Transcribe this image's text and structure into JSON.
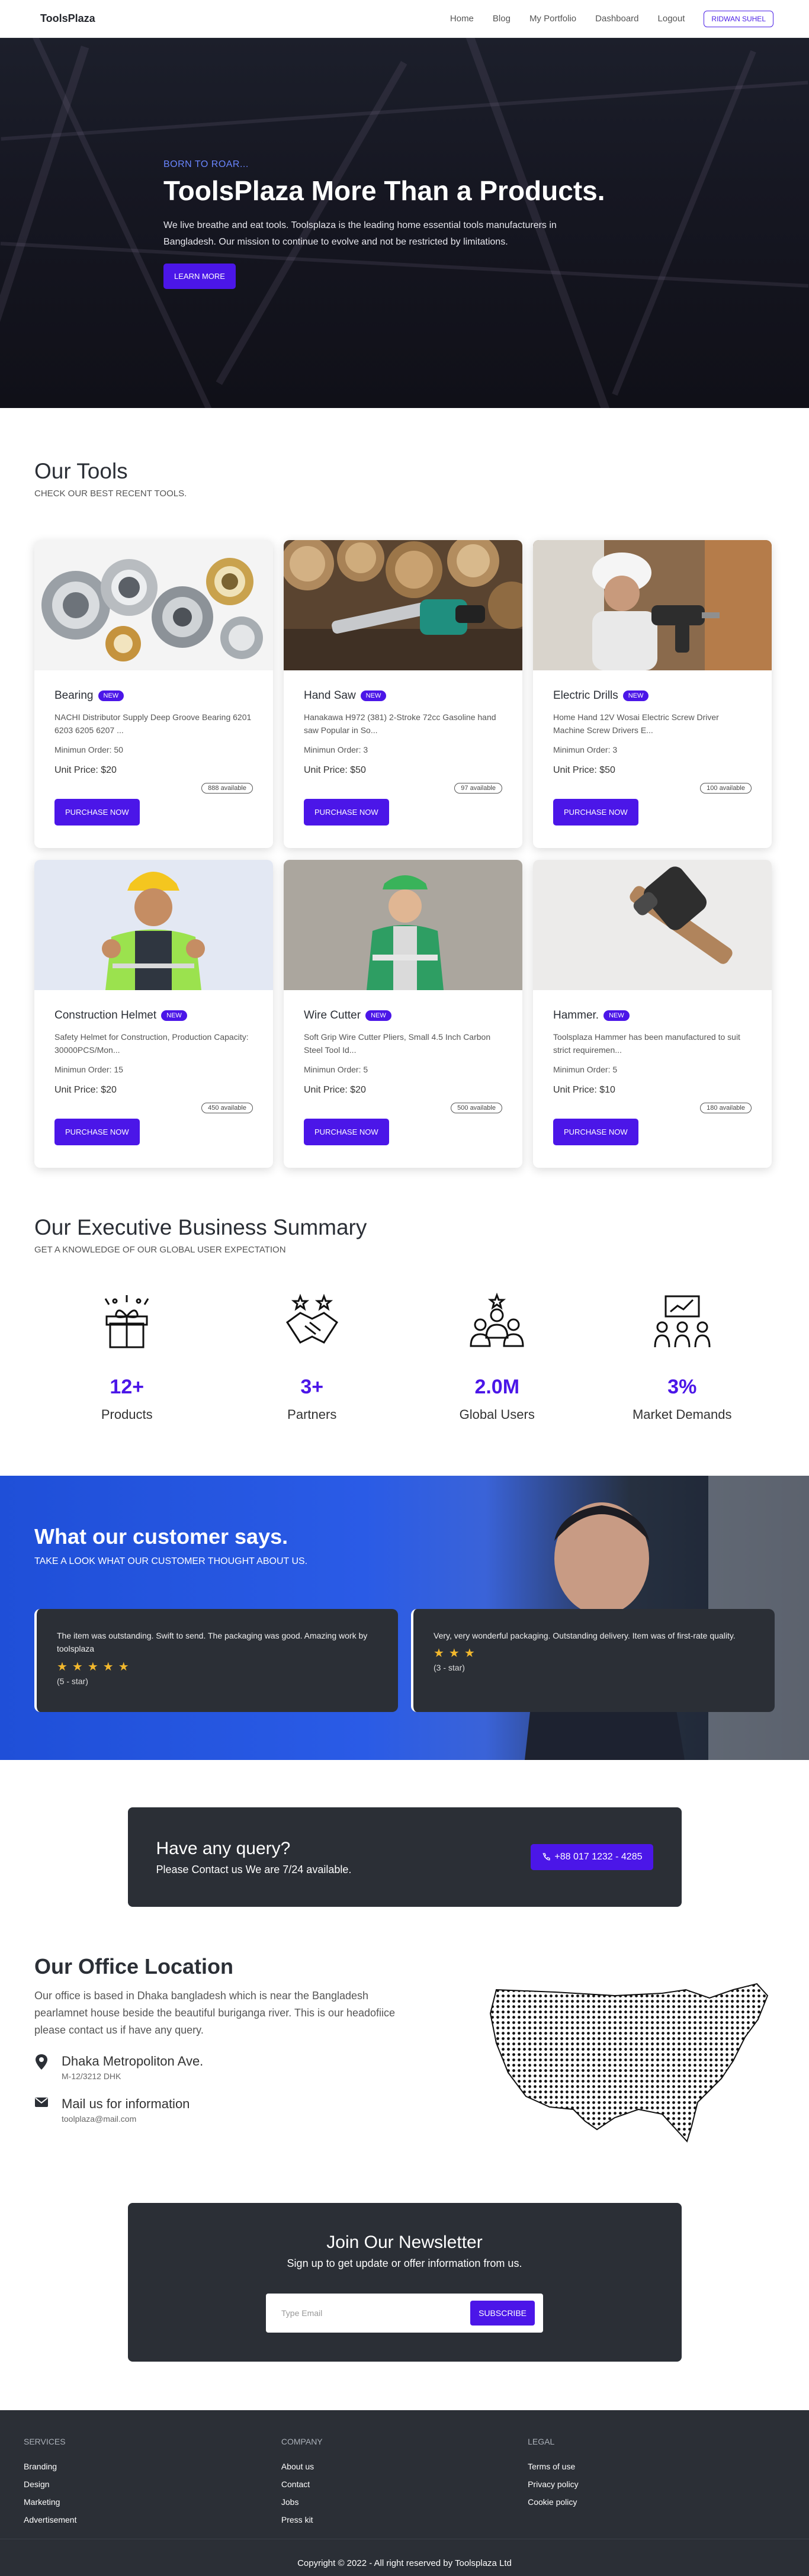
{
  "nav": {
    "brand": "ToolsPlaza",
    "links": [
      "Home",
      "Blog",
      "My Portfolio",
      "Dashboard",
      "Logout"
    ],
    "user": "RIDWAN SUHEL"
  },
  "hero": {
    "eyebrow": "BORN TO ROAR...",
    "title": "ToolsPlaza More Than a Products.",
    "text": "We live breathe and eat tools. Toolsplaza is the leading home essential tools manufacturers in Bangladesh. Our mission to continue to evolve and not be restricted by limitations.",
    "button": "LEARN MORE"
  },
  "tools": {
    "title": "Our Tools",
    "subtitle": "CHECK OUR BEST RECENT TOOLS.",
    "badge": "NEW",
    "button": "PURCHASE NOW",
    "items": [
      {
        "name": "Bearing",
        "desc": "NACHI Distributor Supply Deep Groove Bearing 6201 6203 6205 6207 ...",
        "min": "Minimun Order: 50",
        "price": "Unit Price: $20",
        "available": "888 available"
      },
      {
        "name": "Hand Saw",
        "desc": "Hanakawa H972 (381) 2-Stroke 72cc Gasoline hand saw Popular in So...",
        "min": "Minimun Order: 3",
        "price": "Unit Price: $50",
        "available": "97 available"
      },
      {
        "name": "Electric Drills",
        "desc": "Home Hand 12V Wosai Electric Screw Driver Machine Screw Drivers E...",
        "min": "Minimun Order: 3",
        "price": "Unit Price: $50",
        "available": "100 available"
      },
      {
        "name": "Construction Helmet",
        "desc": "Safety Helmet for Construction, Production Capacity: 30000PCS/Mon...",
        "min": "Minimun Order: 15",
        "price": "Unit Price: $20",
        "available": "450 available"
      },
      {
        "name": "Wire Cutter",
        "desc": "Soft Grip Wire Cutter Pliers, Small 4.5 Inch Carbon Steel Tool Id...",
        "min": "Minimun Order: 5",
        "price": "Unit Price: $20",
        "available": "500 available"
      },
      {
        "name": "Hammer.",
        "desc": "Toolsplaza Hammer has been manufactured to suit strict requiremen...",
        "min": "Minimun Order: 5",
        "price": "Unit Price: $10",
        "available": "180 available"
      }
    ]
  },
  "summary": {
    "title": "Our Executive Business Summary",
    "subtitle": "GET A KNOWLEDGE OF OUR GLOBAL USER EXPECTATION",
    "stats": [
      {
        "value": "12+",
        "label": "Products",
        "icon": "gift-box-icon"
      },
      {
        "value": "3+",
        "label": "Partners",
        "icon": "handshake-icon"
      },
      {
        "value": "2.0M",
        "label": "Global Users",
        "icon": "users-icon"
      },
      {
        "value": "3%",
        "label": "Market Demands",
        "icon": "presentation-icon"
      }
    ]
  },
  "testimonials": {
    "title": "What our customer says.",
    "subtitle": "TAKE A LOOK WHAT OUR CUSTOMER THOUGHT ABOUT US.",
    "reviews": [
      {
        "text": "The item was outstanding. Swift to send. The packaging was good. Amazing work by toolsplaza",
        "stars": "★★★★★",
        "rating": "(5 - star)"
      },
      {
        "text": "Very, very wonderful packaging. Outstanding delivery. Item was of first-rate quality.",
        "stars": "★★★",
        "rating": "(3 - star)"
      }
    ]
  },
  "query": {
    "title": "Have any query?",
    "subtitle": "Please Contact us We are 7/24 available.",
    "phone": "+88 017 1232 - 4285"
  },
  "office": {
    "title": "Our Office Location",
    "text": "Our office is based in Dhaka bangladesh which is near the Bangladesh pearlamnet house beside the beautiful buriganga river. This is our headofiice please contact us if have any query.",
    "address": {
      "main": "Dhaka Metropoliton Ave.",
      "sub": "M-12/3212 DHK"
    },
    "mail": {
      "main": "Mail us for information",
      "sub": "toolplaza@mail.com"
    }
  },
  "newsletter": {
    "title": "Join Our Newsletter",
    "subtitle": "Sign up to get update or offer information from us.",
    "placeholder": "Type Email",
    "button": "SUBSCRIBE"
  },
  "footer": {
    "services": {
      "title": "SERVICES",
      "links": [
        "Branding",
        "Design",
        "Marketing",
        "Advertisement"
      ]
    },
    "company": {
      "title": "COMPANY",
      "links": [
        "About us",
        "Contact",
        "Jobs",
        "Press kit"
      ]
    },
    "legal": {
      "title": "LEGAL",
      "links": [
        "Terms of use",
        "Privacy policy",
        "Cookie policy"
      ]
    },
    "copyright": "Copyright © 2022 - All right reserved by Toolsplaza Ltd"
  },
  "colors": {
    "accent": "#4b16e8",
    "dark": "#2b2f36",
    "star": "#f2b82d"
  }
}
